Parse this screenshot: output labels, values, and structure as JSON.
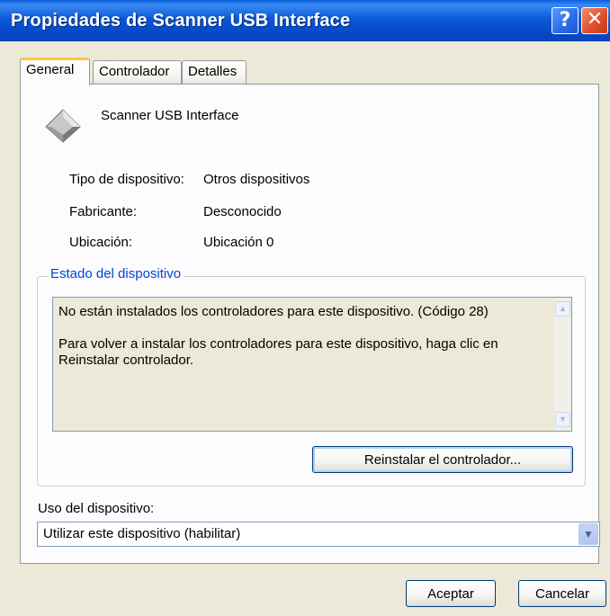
{
  "window": {
    "title": "Propiedades de Scanner USB Interface",
    "help_button": "?",
    "close_button": "✕"
  },
  "tabs": [
    {
      "label": "General",
      "active": true
    },
    {
      "label": "Controlador",
      "active": false
    },
    {
      "label": "Detalles",
      "active": false
    }
  ],
  "device": {
    "icon": "device-diamond-icon",
    "name": "Scanner USB Interface",
    "properties": [
      {
        "label": "Tipo de dispositivo:",
        "value": "Otros dispositivos"
      },
      {
        "label": "Fabricante:",
        "value": "Desconocido"
      },
      {
        "label": "Ubicación:",
        "value": "Ubicación 0"
      }
    ]
  },
  "status": {
    "group_label": "Estado del dispositivo",
    "line1": "No están instalados los controladores para este dispositivo. (Código 28)",
    "line2": "Para volver a instalar los controladores para este dispositivo, haga clic en Reinstalar controlador.",
    "reinstall_button": "Reinstalar el controlador..."
  },
  "usage": {
    "label": "Uso del dispositivo:",
    "selected": "Utilizar este dispositivo (habilitar)"
  },
  "footer": {
    "accept_button": "Aceptar",
    "cancel_button": "Cancelar"
  },
  "colors": {
    "titlebar": "#0A5FDC",
    "group_label": "#0046D5",
    "dialog_bg": "#ECE9D8",
    "panel_bg": "#FCFCFE"
  }
}
